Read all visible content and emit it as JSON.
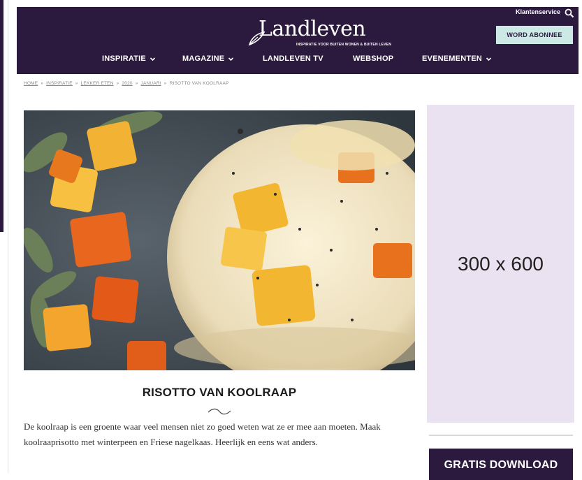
{
  "brand": {
    "name": "Landleven",
    "tagline": "INSPIRATIE VOOR BUITEN WONEN & BUITEN LEVEN"
  },
  "header": {
    "service_link": "Klantenservice",
    "subscribe_label": "WORD ABONNEE",
    "colors": {
      "header_bg": "#2c1a3e",
      "subscribe_bg": "#cde9e6"
    }
  },
  "nav": {
    "items": [
      {
        "label": "INSPIRATIE",
        "has_dropdown": true
      },
      {
        "label": "MAGAZINE",
        "has_dropdown": true
      },
      {
        "label": "LANDLEVEN TV",
        "has_dropdown": false
      },
      {
        "label": "WEBSHOP",
        "has_dropdown": false
      },
      {
        "label": "EVENEMENTEN",
        "has_dropdown": true
      }
    ]
  },
  "breadcrumb": {
    "items": [
      "HOME",
      "INSPIRATIE",
      "LEKKER ETEN",
      "2020",
      "JANUARI",
      "RISOTTO VAN KOOLRAAP"
    ],
    "separator": "»"
  },
  "article": {
    "title": "RISOTTO VAN KOOLRAAP",
    "intro": "De koolraap is een groente waar veel mensen niet zo goed weten wat ze er mee aan moeten. Maak koolraaprisotto met winterpeen en Friese nagelkaas. Heerlijk en eens wat anders."
  },
  "sidebar": {
    "ad_placeholder": "300 x 600",
    "ad_bg": "#ebe2f1",
    "download_label": "GRATIS DOWNLOAD"
  }
}
